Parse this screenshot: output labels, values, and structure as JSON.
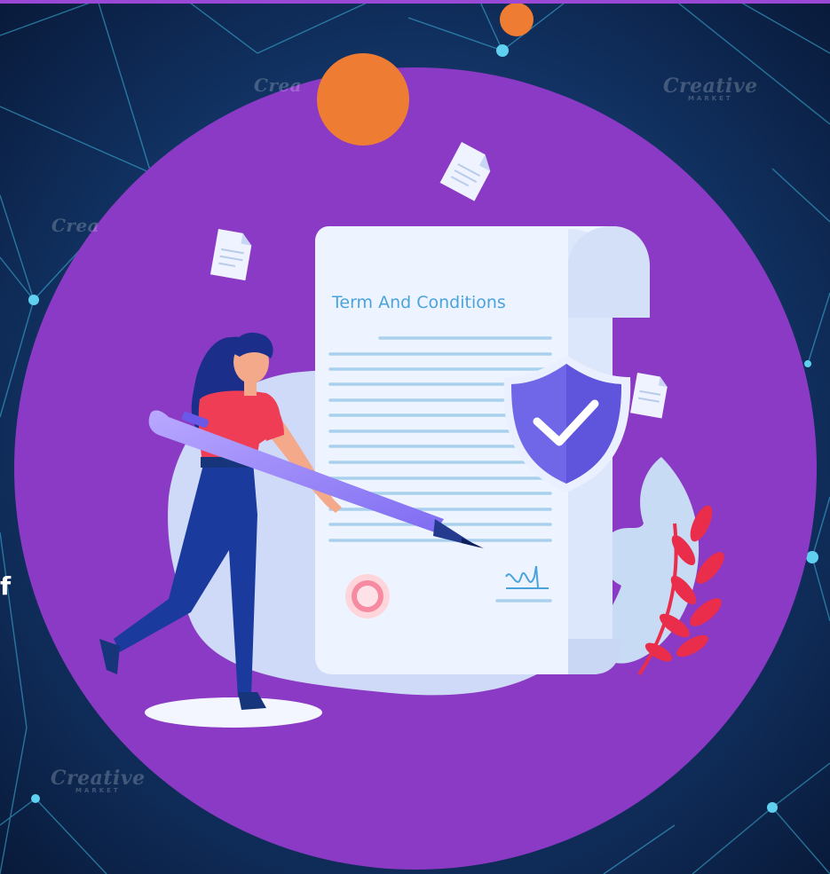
{
  "document": {
    "title": "Term And Conditions"
  },
  "edge_text": "f",
  "watermarks": [
    {
      "text": "Creative",
      "sub": "MARKET"
    },
    {
      "text": "Creative",
      "sub": "MARKET"
    },
    {
      "text": "Crea",
      "sub": ""
    },
    {
      "text": "Crea",
      "sub": ""
    }
  ],
  "icons": {
    "shield": "shield-check-icon",
    "stamp": "seal-stamp-icon",
    "signature": "signature-icon",
    "pen": "pen-icon"
  },
  "colors": {
    "background": "#0b1f45",
    "circle": "#8a3ac4",
    "orange_dot": "#ee7d33",
    "document": "#eef4ff",
    "document_lines": "#a9d1ee",
    "title_text": "#4aa3dc",
    "shield": "#6f67e8",
    "leaves": "#ea2d4a",
    "top_strip": "#9a48d6"
  }
}
